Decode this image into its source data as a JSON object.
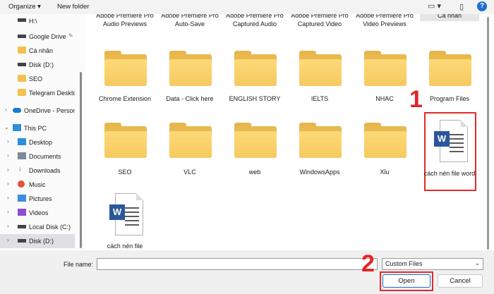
{
  "toolbar": {
    "organize": "Organize ▾",
    "new_folder": "New folder",
    "view_icon": "view-icon",
    "help": "?"
  },
  "nav": {
    "items": [
      {
        "label": "H:\\",
        "icon": "drive-icon",
        "pinned": true
      },
      {
        "label": "Google Drive",
        "icon": "drive-icon",
        "pinned": true
      },
      {
        "label": "Cá nhân",
        "icon": "folder-icon"
      },
      {
        "label": "Disk (D:)",
        "icon": "drive-icon"
      },
      {
        "label": "SEO",
        "icon": "folder-icon"
      },
      {
        "label": "Telegram Desktop",
        "icon": "folder-icon"
      },
      {
        "label": "OneDrive - Personal",
        "icon": "cloud-icon"
      },
      {
        "label": "This PC",
        "icon": "pc-icon"
      },
      {
        "label": "Desktop",
        "icon": "desktop-icon"
      },
      {
        "label": "Documents",
        "icon": "documents-icon"
      },
      {
        "label": "Downloads",
        "icon": "download-icon"
      },
      {
        "label": "Music",
        "icon": "music-icon"
      },
      {
        "label": "Pictures",
        "icon": "pictures-icon"
      },
      {
        "label": "Videos",
        "icon": "videos-icon"
      },
      {
        "label": "Local Disk (C:)",
        "icon": "drive-icon"
      },
      {
        "label": "Disk (D:)",
        "icon": "drive-icon",
        "selected": true
      }
    ]
  },
  "content": {
    "top_labels": [
      "Adobe Premiere Pro Audio Previews",
      "Adobe Premiere Pro Auto-Save",
      "Adobe Premiere Pro Captured Audio",
      "Adobe Premiere Pro Captured Video",
      "Adobe Premiere Pro Video Previews",
      "Cá nhân"
    ],
    "row1": [
      "Chrome Extension",
      "Data - Click here",
      "ENGLISH STORY",
      "IELTS",
      "NHAC",
      "Program Files"
    ],
    "row2": [
      "SEO",
      "VLC",
      "web",
      "WindowsApps",
      "Xỉu"
    ],
    "doc_selected": "cách nén file word",
    "doc_other": "cách nén file"
  },
  "annotations": {
    "step1": "1",
    "step2": "2",
    "accent": "#e32a2a"
  },
  "footer": {
    "file_name_label": "File name:",
    "file_name_value": "",
    "filter_label": "Custom Files",
    "open_label": "Open",
    "cancel_label": "Cancel"
  }
}
